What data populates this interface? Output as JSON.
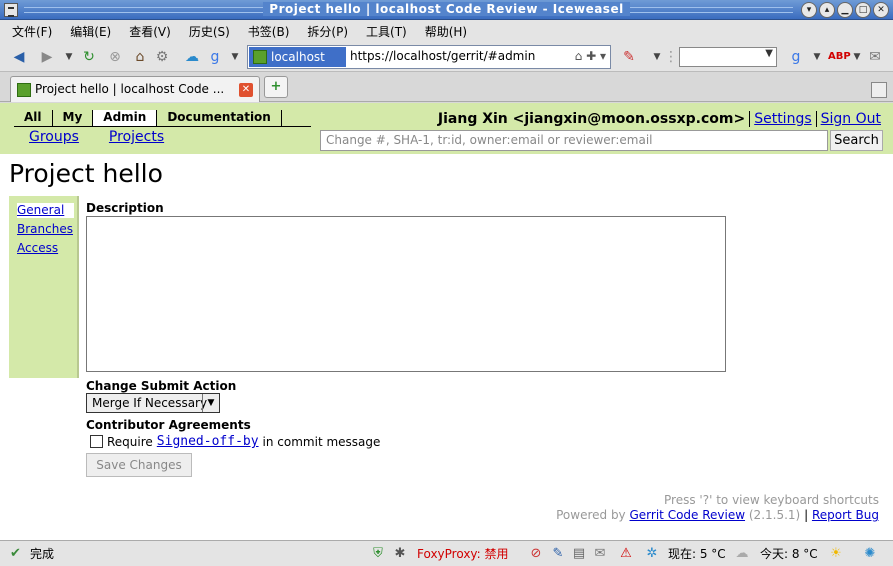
{
  "window": {
    "title": "Project hello | localhost Code Review - Iceweasel"
  },
  "menu": {
    "items": [
      "文件(F)",
      "编辑(E)",
      "查看(V)",
      "历史(S)",
      "书签(B)",
      "拆分(P)",
      "工具(T)",
      "帮助(H)"
    ]
  },
  "navbar": {
    "site_label": "localhost",
    "url": "https://localhost/gerrit/#admin"
  },
  "tab": {
    "label": "Project hello | localhost Code ...",
    "close_glyph": "✕",
    "new_glyph": "+"
  },
  "gerrit": {
    "topmenu": [
      "All",
      "My",
      "Admin",
      "Documentation"
    ],
    "topmenu_selected": "Admin",
    "submenu": [
      "Groups",
      "Projects"
    ],
    "user": "Jiang Xin <jiangxin@moon.ossxp.com>",
    "settings_label": "Settings",
    "signout_label": "Sign Out",
    "search_placeholder": "Change #, SHA-1, tr:id, owner:email or reviewer:email",
    "search_button": "Search",
    "page_title": "Project hello",
    "sidenav": [
      "General",
      "Branches",
      "Access"
    ],
    "sidenav_selected": "General",
    "description_label": "Description",
    "description_value": "",
    "submit_action_label": "Change Submit Action",
    "submit_action_value": "Merge If Necessary",
    "agreements_label": "Contributor Agreements",
    "require_prefix": "Require",
    "require_link": "Signed-off-by",
    "require_suffix": "in commit message",
    "save_button": "Save Changes",
    "footer_shortcuts": "Press '?' to view keyboard shortcuts",
    "footer_powered_prefix": "Powered by",
    "footer_link": "Gerrit Code Review",
    "footer_version": "(2.1.5.1)",
    "footer_sep": "|",
    "footer_report": "Report Bug"
  },
  "statusbar": {
    "done": "完成",
    "foxyproxy": "FoxyProxy: 禁用",
    "now": "现在: 5 °C",
    "today": "今天: 8 °C"
  },
  "colors": {
    "gerrit_header": "#d4e9a9",
    "link": "#0000cc",
    "titlebar": "#3a6cbf"
  }
}
